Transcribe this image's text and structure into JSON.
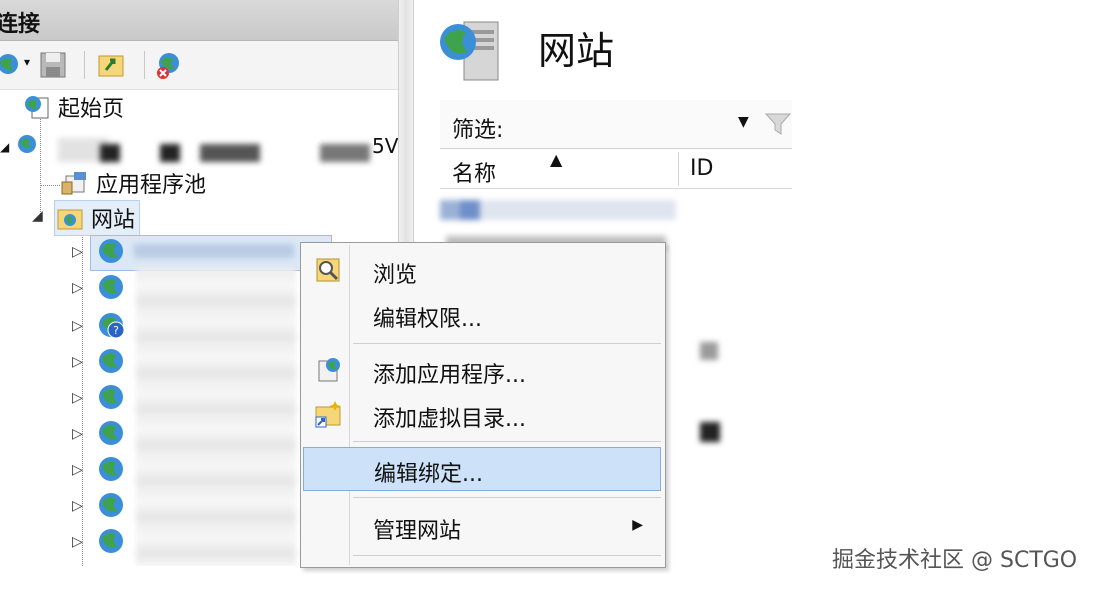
{
  "left_pane": {
    "title": "连接",
    "tree": {
      "start_page": "起始页",
      "server_suffix": "5V",
      "app_pools": "应用程序池",
      "sites": "网站"
    }
  },
  "right_pane": {
    "title": "网站",
    "filter_label": "筛选:",
    "columns": {
      "name": "名称",
      "id": "ID"
    }
  },
  "context_menu": {
    "items": [
      {
        "label": "浏览",
        "icon": "browse-icon"
      },
      {
        "label": "编辑权限...",
        "icon": ""
      },
      {
        "label": "添加应用程序...",
        "icon": "add-application-icon"
      },
      {
        "label": "添加虚拟目录...",
        "icon": "add-virtual-directory-icon"
      },
      {
        "label": "编辑绑定...",
        "icon": "",
        "highlighted": true
      },
      {
        "label": "管理网站",
        "icon": "",
        "has_submenu": true
      }
    ]
  },
  "watermark": "掘金技术社区 @ SCTGO",
  "colors": {
    "highlight": "#cde2f8",
    "highlight_border": "#84ace0",
    "selection": "#dbe8f6"
  }
}
